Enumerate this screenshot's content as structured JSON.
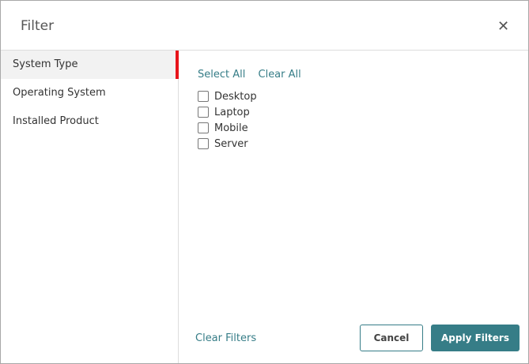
{
  "dialog": {
    "title": "Filter",
    "close_icon": "close-icon"
  },
  "sidebar": {
    "items": [
      {
        "label": "System Type",
        "active": true
      },
      {
        "label": "Operating System"
      },
      {
        "label": "Installed Product"
      }
    ]
  },
  "main": {
    "select_all": "Select All",
    "clear_all": "Clear All",
    "options": [
      {
        "label": "Desktop",
        "checked": false
      },
      {
        "label": "Laptop",
        "checked": false
      },
      {
        "label": "Mobile",
        "checked": false
      },
      {
        "label": "Server",
        "checked": false
      }
    ]
  },
  "footer": {
    "clear_filters": "Clear Filters",
    "cancel": "Cancel",
    "apply": "Apply Filters"
  },
  "colors": {
    "accent": "#367d87",
    "active_marker": "#e8141b"
  }
}
